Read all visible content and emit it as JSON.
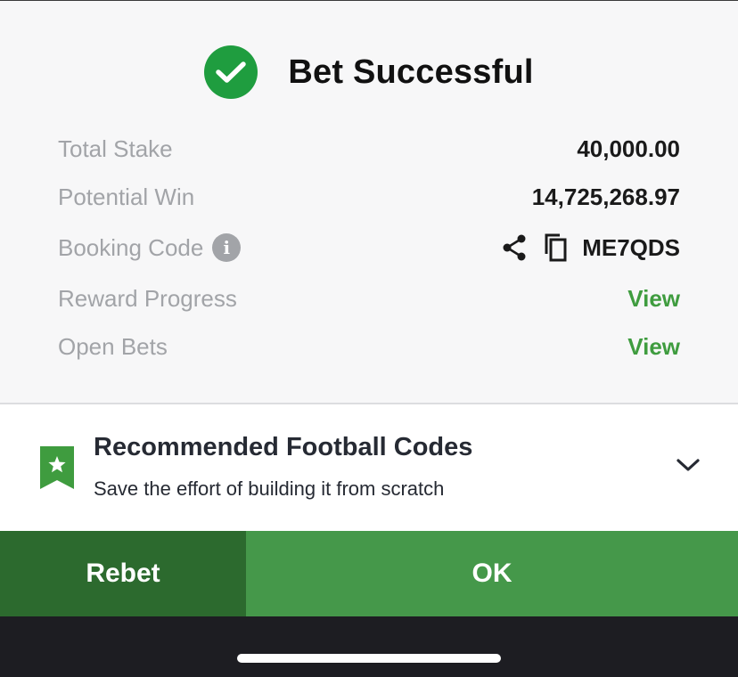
{
  "header": {
    "title": "Bet Successful",
    "icon": "check-circle-icon",
    "icon_color": "#1f9d3f"
  },
  "summary": {
    "rows": [
      {
        "label": "Total Stake",
        "value": "40,000.00"
      },
      {
        "label": "Potential Win",
        "value": "14,725,268.97"
      },
      {
        "label": "Booking Code",
        "value": "ME7QDS",
        "icons": [
          "info-icon",
          "share-icon",
          "copy-icon"
        ]
      },
      {
        "label": "Reward Progress",
        "link": "View"
      },
      {
        "label": "Open Bets",
        "link": "View"
      }
    ],
    "link_color": "#3f9c3f"
  },
  "recommend": {
    "title": "Recommended Football Codes",
    "subtitle": "Save the effort of building it from scratch",
    "icon": "bookmark-star-icon",
    "expand_icon": "chevron-down-icon"
  },
  "actions": {
    "rebet_label": "Rebet",
    "ok_label": "OK",
    "rebet_color": "#2c6a2e",
    "ok_color": "#45984a"
  }
}
